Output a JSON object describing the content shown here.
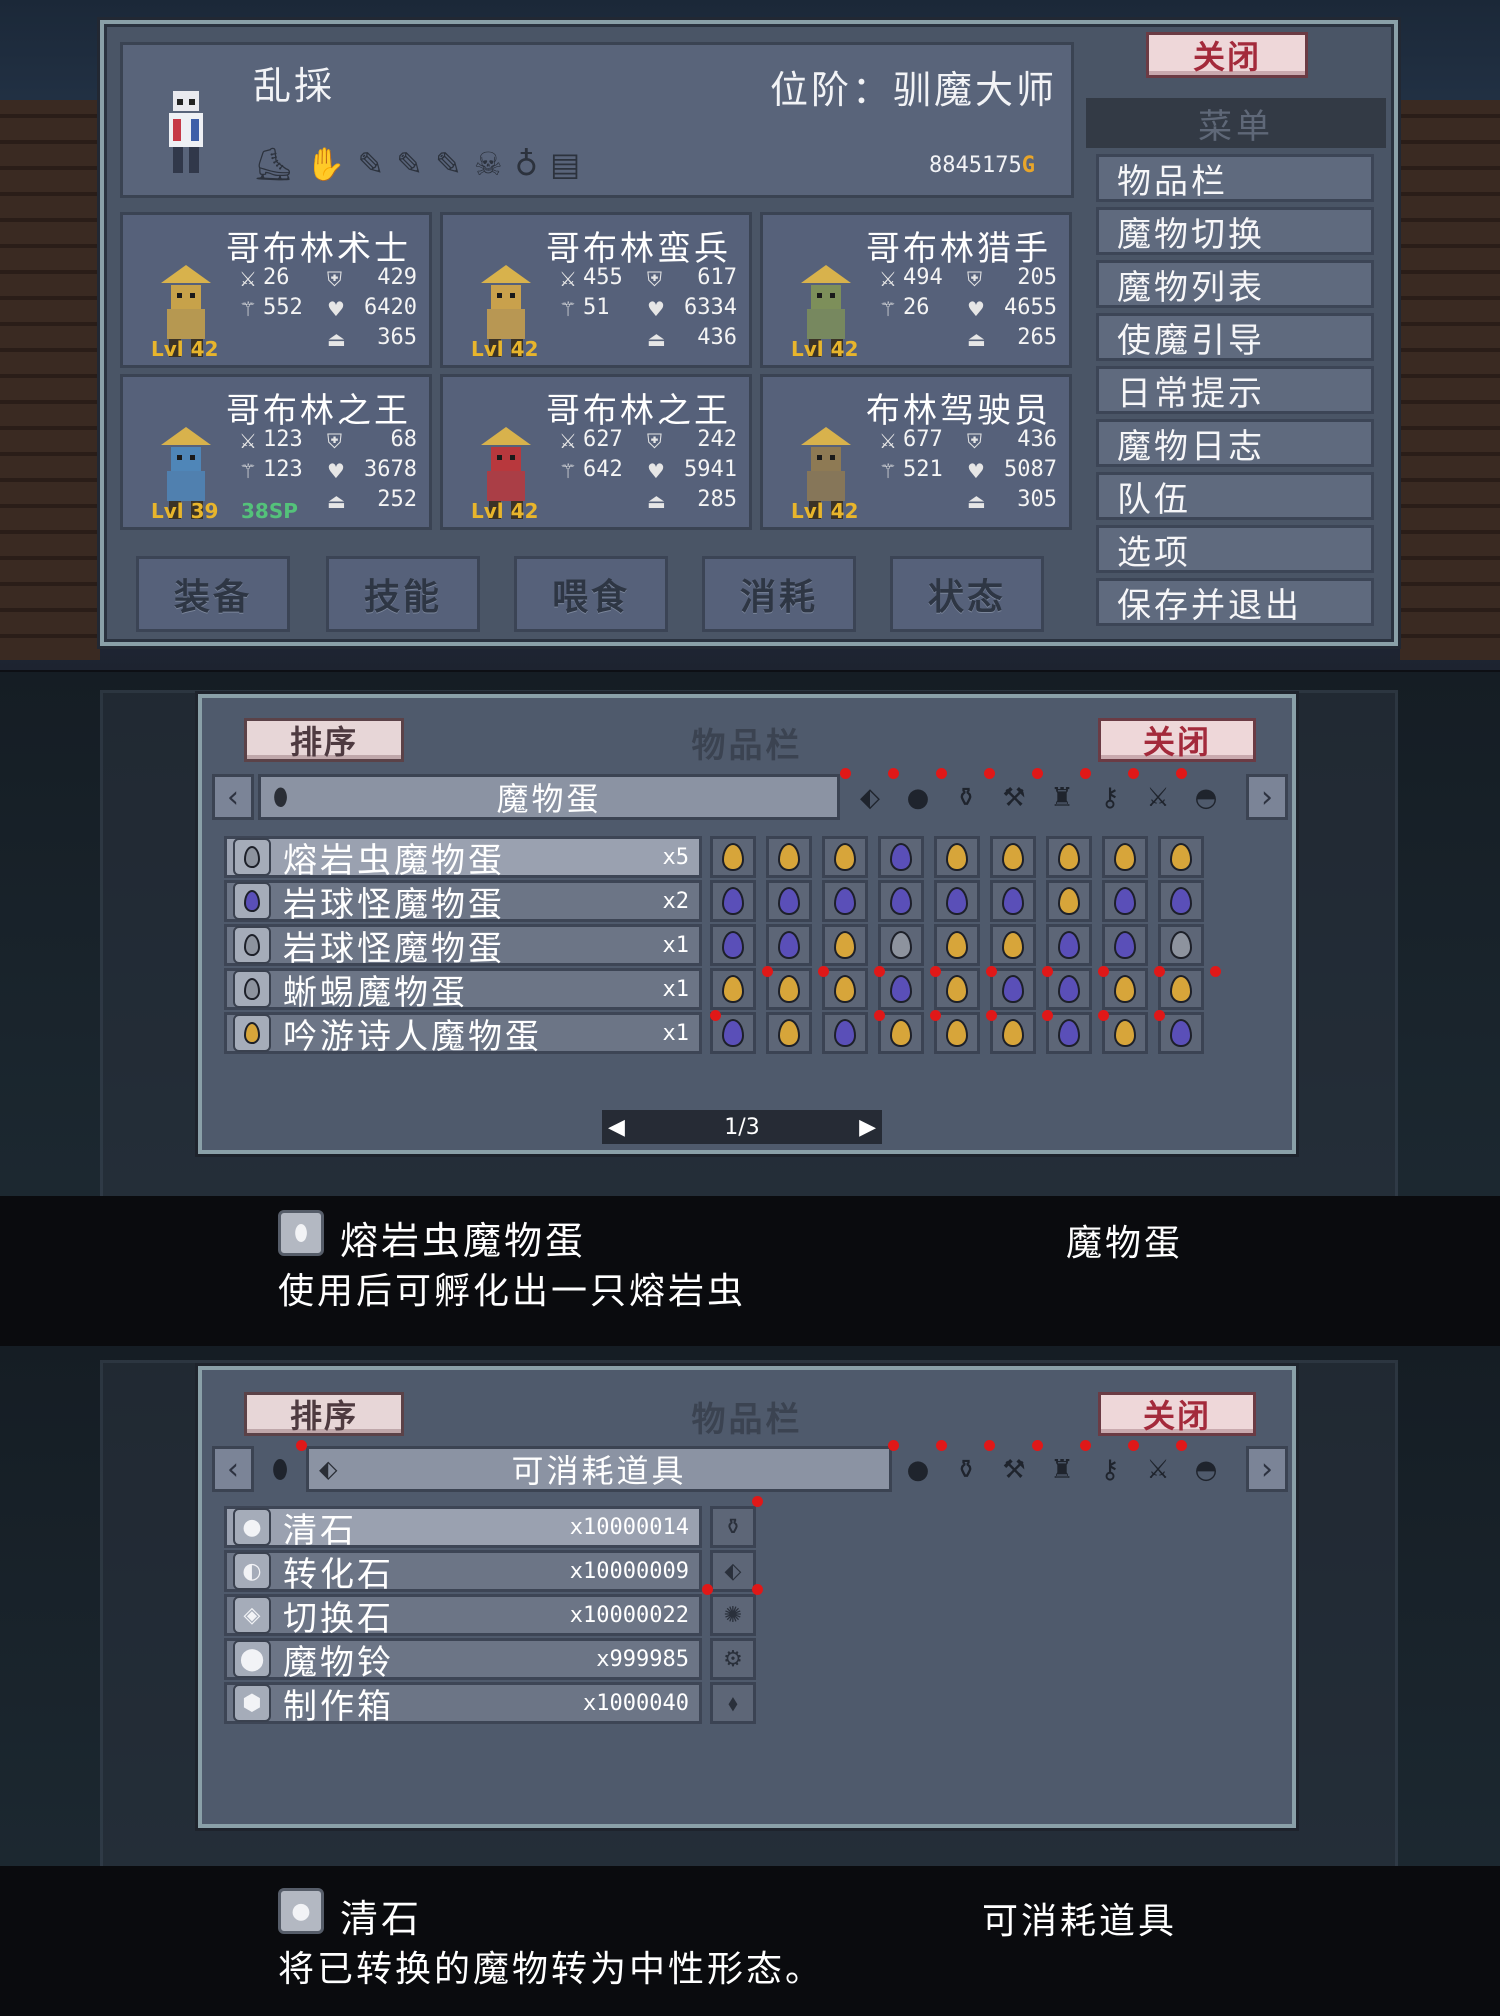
{
  "panel1": {
    "player_name": "乱採",
    "rank_label": "位阶：驯魔大师",
    "gold": "8845175",
    "gold_icon": "G",
    "close_label": "关闭",
    "menu_title": "菜单",
    "menu_items": [
      "物品栏",
      "魔物切换",
      "魔物列表",
      "使魔引导",
      "日常提示",
      "魔物日志",
      "队伍",
      "选项",
      "保存并退出"
    ],
    "bottom_tabs": [
      "装备",
      "技能",
      "喂食",
      "消耗",
      "状态"
    ],
    "monsters": [
      {
        "name": "哥布林术士",
        "atk": "26",
        "def": "429",
        "mag": "552",
        "hp": "6420",
        "mp": "365",
        "level": "Lvl 42",
        "sp": "",
        "color": "#c7a24a"
      },
      {
        "name": "哥布林蛮兵",
        "atk": "455",
        "def": "617",
        "mag": "51",
        "hp": "6334",
        "mp": "436",
        "level": "Lvl 42",
        "sp": "",
        "color": "#c9a14c"
      },
      {
        "name": "哥布林猎手",
        "atk": "494",
        "def": "205",
        "mag": "26",
        "hp": "4655",
        "mp": "265",
        "level": "Lvl 42",
        "sp": "",
        "color": "#7d8f5a"
      },
      {
        "name": "哥布林之王",
        "atk": "123",
        "def": "68",
        "mag": "123",
        "hp": "3678",
        "mp": "252",
        "level": "Lvl 39",
        "sp": "38SP",
        "color": "#4f86b8"
      },
      {
        "name": "哥布林之王",
        "atk": "627",
        "def": "242",
        "mag": "642",
        "hp": "5941",
        "mp": "285",
        "level": "Lvl 42",
        "sp": "",
        "color": "#b8383d"
      },
      {
        "name": "布林驾驶员",
        "atk": "677",
        "def": "436",
        "mag": "521",
        "hp": "5087",
        "mp": "305",
        "level": "Lvl 42",
        "sp": "",
        "color": "#8e7a54"
      }
    ]
  },
  "panel2": {
    "sort_label": "排序",
    "title": "物品栏",
    "close_label": "关闭",
    "category": "魔物蛋",
    "items": [
      {
        "name": "熔岩虫魔物蛋",
        "qty": "x5",
        "icon": "egg-silver"
      },
      {
        "name": "岩球怪魔物蛋",
        "qty": "x2",
        "icon": "egg-purple"
      },
      {
        "name": "岩球怪魔物蛋",
        "qty": "x1",
        "icon": "egg-silver"
      },
      {
        "name": "蜥蜴魔物蛋",
        "qty": "x1",
        "icon": "egg-silver"
      },
      {
        "name": "吟游诗人魔物蛋",
        "qty": "x1",
        "icon": "egg-gold"
      }
    ],
    "grid": [
      [
        "g",
        "g",
        "g",
        "p",
        "g",
        "g",
        "g",
        "g",
        "g"
      ],
      [
        "p",
        "p",
        "p",
        "p",
        "p",
        "p",
        "g",
        "p",
        "p"
      ],
      [
        "p",
        "p",
        "g",
        "s",
        "g",
        "g",
        "p",
        "p",
        "s"
      ],
      [
        "g",
        "g",
        "g",
        "p",
        "g",
        "p",
        "p",
        "g",
        "g"
      ],
      [
        "p",
        "g",
        "p",
        "g",
        "g",
        "g",
        "p",
        "g",
        "p"
      ]
    ],
    "page": "1/3",
    "desc_name": "熔岩虫魔物蛋",
    "desc_text": "使用后可孵化出一只熔岩虫",
    "desc_category": "魔物蛋"
  },
  "panel3": {
    "sort_label": "排序",
    "title": "物品栏",
    "close_label": "关闭",
    "category": "可消耗道具",
    "items": [
      {
        "name": "清石",
        "qty": "x10000014",
        "icon": "clear-stone-icon"
      },
      {
        "name": "转化石",
        "qty": "x10000009",
        "icon": "shift-stone-icon"
      },
      {
        "name": "切换石",
        "qty": "x10000022",
        "icon": "swap-stone-icon"
      },
      {
        "name": "魔物铃",
        "qty": "x999985",
        "icon": "monster-bell-icon"
      },
      {
        "name": "制作箱",
        "qty": "x1000040",
        "icon": "craft-box-icon"
      }
    ],
    "desc_name": "清石",
    "desc_text": "将已转换的魔物转为中性形态。",
    "desc_category": "可消耗道具"
  },
  "colors": {
    "panel": "#4a5566",
    "frame": "#8aa0a8",
    "gold": "#e8b52c",
    "sp": "#54c27a",
    "close_text": "#a32a3b"
  }
}
